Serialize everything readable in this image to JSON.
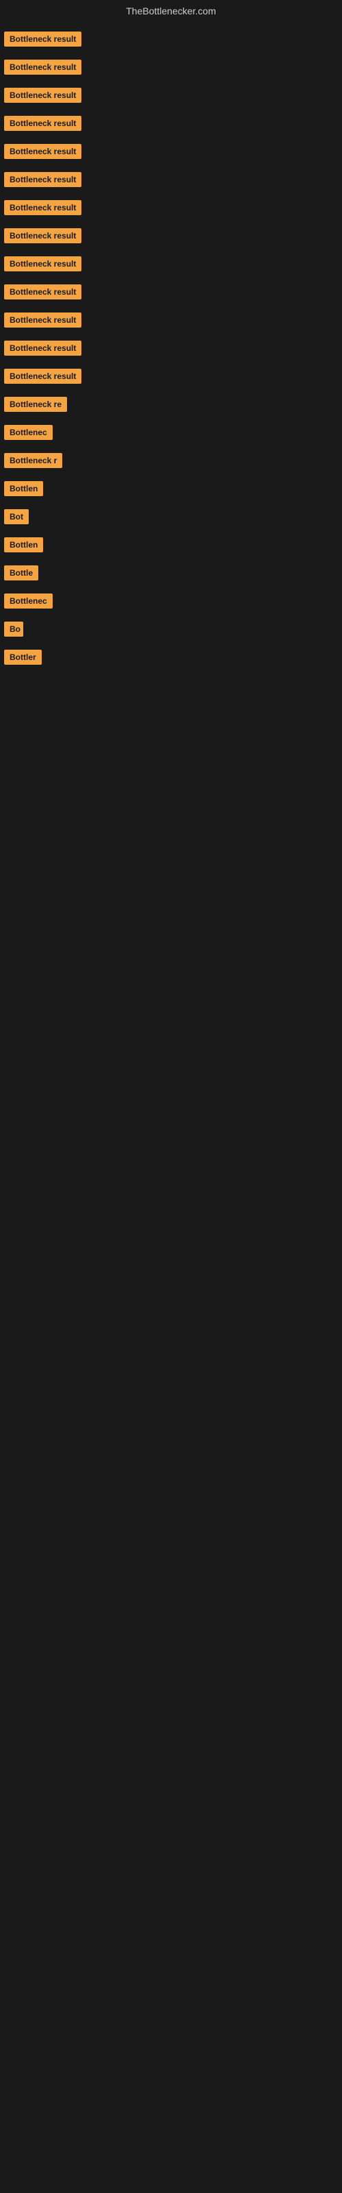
{
  "header": {
    "title": "TheBottlenecker.com"
  },
  "items": [
    {
      "id": 0,
      "label": "Bottleneck result"
    },
    {
      "id": 1,
      "label": "Bottleneck result"
    },
    {
      "id": 2,
      "label": "Bottleneck result"
    },
    {
      "id": 3,
      "label": "Bottleneck result"
    },
    {
      "id": 4,
      "label": "Bottleneck result"
    },
    {
      "id": 5,
      "label": "Bottleneck result"
    },
    {
      "id": 6,
      "label": "Bottleneck result"
    },
    {
      "id": 7,
      "label": "Bottleneck result"
    },
    {
      "id": 8,
      "label": "Bottleneck result"
    },
    {
      "id": 9,
      "label": "Bottleneck result"
    },
    {
      "id": 10,
      "label": "Bottleneck result"
    },
    {
      "id": 11,
      "label": "Bottleneck result"
    },
    {
      "id": 12,
      "label": "Bottleneck result"
    },
    {
      "id": 13,
      "label": "Bottleneck re"
    },
    {
      "id": 14,
      "label": "Bottlenec"
    },
    {
      "id": 15,
      "label": "Bottleneck r"
    },
    {
      "id": 16,
      "label": "Bottlen"
    },
    {
      "id": 17,
      "label": "Bot"
    },
    {
      "id": 18,
      "label": "Bottlen"
    },
    {
      "id": 19,
      "label": "Bottle"
    },
    {
      "id": 20,
      "label": "Bottlenec"
    },
    {
      "id": 21,
      "label": "Bo"
    },
    {
      "id": 22,
      "label": "Bottler"
    }
  ]
}
